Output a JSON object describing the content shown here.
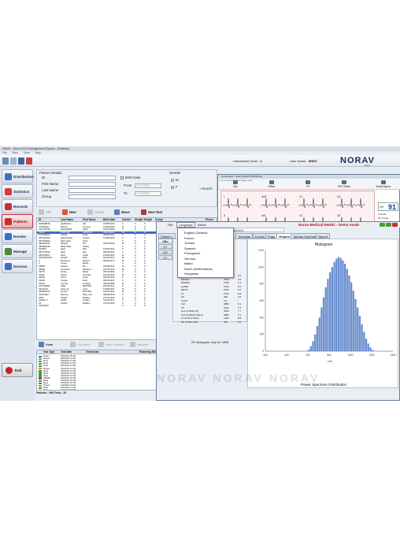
{
  "app": {
    "title": "NEMS - Norav ECG Management System - [Patients]",
    "menu": [
      "File",
      "View",
      "Tools",
      "Help"
    ]
  },
  "header": {
    "unmatched_label": "Unmatched Tests :",
    "unmatched_count": "1",
    "user_label": "User Name :",
    "user_name": "atest",
    "brand": "NORAV",
    "brand_sub": "medical"
  },
  "nav": {
    "items": [
      {
        "label": "Distribution",
        "color": "#3b6fc5"
      },
      {
        "label": "Statistics",
        "color": "#d23b3b"
      },
      {
        "label": "Records",
        "color": "#c83030"
      },
      {
        "label": "Patients",
        "color": "#c83030"
      },
      {
        "label": "Review",
        "color": "#3b6fc5"
      },
      {
        "label": "Manage",
        "color": "#4a8a3a"
      },
      {
        "label": "Devices",
        "color": "#3b6fc5"
      }
    ],
    "exit_label": "Exit"
  },
  "details": {
    "caption": "Patient Details",
    "id_label": "ID",
    "first_label": "First Name",
    "last_label": "Last Name",
    "group_label": "Group",
    "birth_label": "Birth Date",
    "from_label": "From",
    "to_label": "To",
    "from_value": "12/12/2011",
    "to_value": "12/12/2011",
    "gender_label": "Gender",
    "gender_m": "M",
    "gender_f": "F",
    "search_label": "Search"
  },
  "actions": {
    "edit": "Edit",
    "new": "New",
    "delete": "Delete",
    "move": "Move",
    "new_test": "New Test"
  },
  "patients_table": {
    "columns": [
      "ID",
      "Last Name",
      "First Name",
      "Birth Date",
      "Gender",
      "Weight",
      "Height",
      "Group",
      "Phone"
    ],
    "rows": [
      [
        "518648538",
        "dadfdaff-d",
        "fdd",
        "19/05/1926",
        "F",
        "0",
        "0",
        "",
        ""
      ],
      [
        "31302206",
        "Marina",
        "Gummy",
        "01/05/1981",
        "M",
        "0",
        "0",
        "",
        ""
      ],
      [
        "312715758",
        "adfdsfgdfdf",
        "dsfdf",
        "18/01/2005",
        "F",
        "0",
        "0",
        "",
        ""
      ],
      [
        "31143",
        "PORTER",
        "GERALD",
        "05/01/1929",
        "M",
        "0",
        "0",
        "",
        ""
      ],
      [
        "374148629",
        "rahtall",
        "Gabi",
        "05/05/1951",
        "F",
        "0",
        "0",
        "",
        ""
      ],
      [
        "387431834",
        "gdsvxdsdss",
        "sxcdvx",
        "14/06/1925",
        "F",
        "0",
        "0",
        "",
        ""
      ],
      [
        "387135394",
        "DEV-Gabi",
        "Gabi",
        "",
        "F",
        "0",
        "0",
        "",
        ""
      ],
      [
        "389000341",
        "dfdsfds",
        "fds",
        "05/01/1920",
        "M",
        "0",
        "0",
        "",
        ""
      ],
      [
        "386686048",
        "MINSTER",
        "ANNA",
        "",
        "F",
        "0",
        "0",
        "",
        ""
      ],
      [
        "360006",
        "aklui",
        "dfrtr",
        "19/02/1991",
        "F",
        "0",
        "0",
        "",
        ""
      ],
      [
        "353770033",
        "aklui",
        "lala",
        "05/01/1924",
        "F",
        "0",
        "0",
        "",
        ""
      ],
      [
        "383765527",
        "aklui",
        "xsdfd",
        "15/06/1933",
        "M",
        "0",
        "0",
        "",
        ""
      ],
      [
        "381630408-5",
        "dsdsfd",
        "dfdd",
        "01/01/1967",
        "M",
        "0",
        "0",
        "",
        ""
      ],
      [
        "5",
        "Bowhaus",
        "Robert",
        "09/03/1970",
        "M",
        "0",
        "0",
        "",
        ""
      ],
      [
        "3",
        "Green",
        "Maria",
        "",
        "F",
        "0",
        "0",
        "",
        ""
      ],
      [
        "29865",
        "Anders",
        "Bo",
        "24/06/1967",
        "M",
        "0",
        "0",
        "",
        ""
      ],
      [
        "28992",
        "Gretchen",
        "Manfred",
        "27/07/1934",
        "M",
        "0",
        "0",
        "",
        ""
      ],
      [
        "29779",
        "Nurse",
        "Maria",
        "25/11/1963",
        "F",
        "0",
        "0",
        "",
        ""
      ],
      [
        "29111",
        "Name",
        "Osmalis",
        "01/01/1943",
        "M",
        "0",
        "0",
        "",
        ""
      ],
      [
        "29064",
        "Smid",
        "Cara",
        "01/03/1962",
        "F",
        "0",
        "0",
        "",
        ""
      ],
      [
        "29018",
        "Fesper",
        "Ruth",
        "05/10/1947",
        "F",
        "0",
        "0",
        "",
        ""
      ],
      [
        "26415",
        "mornal",
        "smolten",
        "05/10/1983",
        "M",
        "0",
        "0",
        "",
        ""
      ],
      [
        "247109082",
        "Valle",
        "BROWN",
        "01/01/1911",
        "F",
        "0",
        "0",
        "",
        ""
      ],
      [
        "262729-9",
        "shannon",
        "enter",
        "12/06/1967",
        "M",
        "0",
        "0",
        "",
        ""
      ],
      [
        "256800014",
        "Hunter",
        "MOORE",
        "01/01/1961",
        "M",
        "0",
        "0",
        "",
        ""
      ],
      [
        "25412062",
        "Mannie",
        "Mary Ann",
        "28/06/1936",
        "F",
        "0",
        "0",
        "",
        ""
      ],
      [
        "2460",
        "Schiltz",
        "Madlen",
        "27/07/1934",
        "F",
        "0",
        "0",
        "",
        ""
      ],
      [
        "244037-7",
        "AANT",
        "Guillen",
        "01/01/1911",
        "F",
        "0",
        "0",
        "",
        ""
      ],
      [
        "24",
        "Schiltz",
        "Madlen",
        "27/07/1934",
        "F",
        "0",
        "0",
        "",
        ""
      ],
      [
        "23094067",
        "",
        "",
        "",
        "F",
        "0",
        "0",
        "",
        ""
      ]
    ],
    "selected_index": 3
  },
  "tests_toolbar": {
    "view": "View",
    "compare": "Compare",
    "view_reports": "View Reports",
    "preview": "Preview"
  },
  "tests_table": {
    "columns": [
      "Test Type",
      "Test Date",
      "Technician",
      "Returning MD"
    ],
    "rows": [
      [
        "Holter",
        "29/10/10 09:10",
        ""
      ],
      [
        "Stress",
        "25/10/10 11:00",
        ""
      ],
      [
        "Rest",
        "22/10/10 11:02",
        ""
      ],
      [
        "Rest",
        "22/10/10 11:20",
        ""
      ],
      [
        "Rest",
        "22/10/10 11:06",
        ""
      ],
      [
        "Stress",
        "22/10/10 11:44",
        ""
      ],
      [
        "Rest",
        "22/10/10 11:08",
        ""
      ],
      [
        "Rest",
        "22/10/10 11:45",
        ""
      ],
      [
        "Rest",
        "21/10/10 10:22",
        ""
      ],
      [
        "ABPM",
        "14/10/10 10:50",
        ""
      ],
      [
        "Rest",
        "14/10/10 10:08",
        ""
      ],
      [
        "Rest",
        "14/10/10 10:04",
        ""
      ],
      [
        "Stress",
        "14/10/10 13:00",
        ""
      ],
      [
        "Rest",
        "14/10/10 11:00",
        ""
      ],
      [
        "Rest",
        "14/10/10 10:20",
        ""
      ]
    ]
  },
  "footer": {
    "count": "Patients : 968  Tests : 33"
  },
  "ecg_window": {
    "title": "Norav ECG - Scan 1/2/1975 [18:05:40]",
    "menu": "Zoom  Views/Filt  Print  Pages  Help",
    "tools": [
      "Sav",
      "Offset",
      "Fil",
      "PDF Batch",
      "Detail Agree"
    ],
    "hr_label": "HR",
    "hr_value": "91",
    "lead_labels": [
      "I",
      "II",
      "III",
      "aVR",
      "aVL",
      "aVF",
      "V1",
      "V2",
      "V3",
      "V4",
      "V5",
      "V6",
      "II"
    ],
    "side": [
      "Time/div",
      "25 mm/sec",
      "Amplitude",
      "10 mm/mV",
      "PR",
      "QRS",
      "QT/QTc",
      "P-R-T Axes",
      "RR(ms)",
      "RR(min)",
      "R-Rpt",
      "R-Rpeak"
    ]
  },
  "hrv_window": {
    "menu": [
      "File",
      "Language",
      "About"
    ],
    "title": "Norav Medical NH301 - Demo mode",
    "patient_line": "Patient: ,dmd  Date ID: 00000000",
    "tabs": [
      "Patient L",
      "Template",
      "Events",
      "Page",
      "Graphs",
      "Tabular Summary",
      "Report"
    ],
    "active_tab": 4,
    "left_tabs": [
      "HRV",
      "QT",
      "QTc",
      "ST"
    ],
    "languages": [
      "English (Default)",
      "French",
      "Turkish",
      "Spanish",
      "Portuguese",
      "German",
      "Italian",
      "Dutch (Netherlands)",
      "Hungarian"
    ],
    "hist_title": "Histogram",
    "hist_caption": "2D histogram only for NNN",
    "spectrum_title": "Power Spectrum Distribution",
    "x_axis_label": "ms",
    "stats": [
      [
        "SDNN",
        "2850",
        "4.9"
      ],
      [
        "SDANN",
        "2700",
        "3.5"
      ],
      [
        "RMSSD",
        "1540",
        "2.1"
      ],
      [
        "pNN50",
        "1530",
        "2.0"
      ],
      [
        "HRVTI",
        "1530",
        "2.0"
      ],
      [
        "LF",
        "1180",
        "8.8"
      ],
      [
        "HF",
        "420",
        "3.6"
      ],
      [
        "LF/HF",
        "3.2",
        "-"
      ],
      [
        "VLF",
        "2880",
        "6.1"
      ],
      [
        "TP",
        "4120",
        "1.5"
      ],
      [
        "ULF (0.0033 Hz)",
        "2665",
        "7.7"
      ],
      [
        "VLF (0.0033-0.04Hz)",
        "2880",
        "6.1"
      ],
      [
        "LF (0.04-0.15Hz)",
        "1180",
        "8.8"
      ],
      [
        "HF (0.15-0.4Hz)",
        "420",
        "3.6"
      ]
    ],
    "watermark": "NORAV   NORAV   NORAV"
  },
  "chart_data": {
    "type": "bar",
    "title": "Histogram",
    "xlabel": "ms",
    "ylabel": "",
    "x_ticks": [
      "200",
      "400",
      "600",
      "800",
      "1000",
      "1200",
      "1400"
    ],
    "y_ticks": [
      "0",
      "200",
      "400",
      "600",
      "800",
      "1000",
      "1200"
    ],
    "xlim": [
      200,
      1400
    ],
    "ylim": [
      0,
      1200
    ],
    "categories": [
      "600",
      "620",
      "640",
      "660",
      "680",
      "700",
      "720",
      "740",
      "760",
      "780",
      "800",
      "820",
      "840",
      "860",
      "880",
      "900",
      "920",
      "940",
      "960",
      "980",
      "1000",
      "1020",
      "1040",
      "1060",
      "1080",
      "1100",
      "1120",
      "1140",
      "1160",
      "1180",
      "1200"
    ],
    "values": [
      20,
      60,
      120,
      200,
      300,
      400,
      520,
      640,
      760,
      860,
      940,
      1000,
      1060,
      1100,
      1120,
      1110,
      1080,
      1040,
      980,
      900,
      820,
      720,
      620,
      520,
      420,
      320,
      230,
      150,
      90,
      45,
      15
    ],
    "color": "#6a8fd0"
  }
}
